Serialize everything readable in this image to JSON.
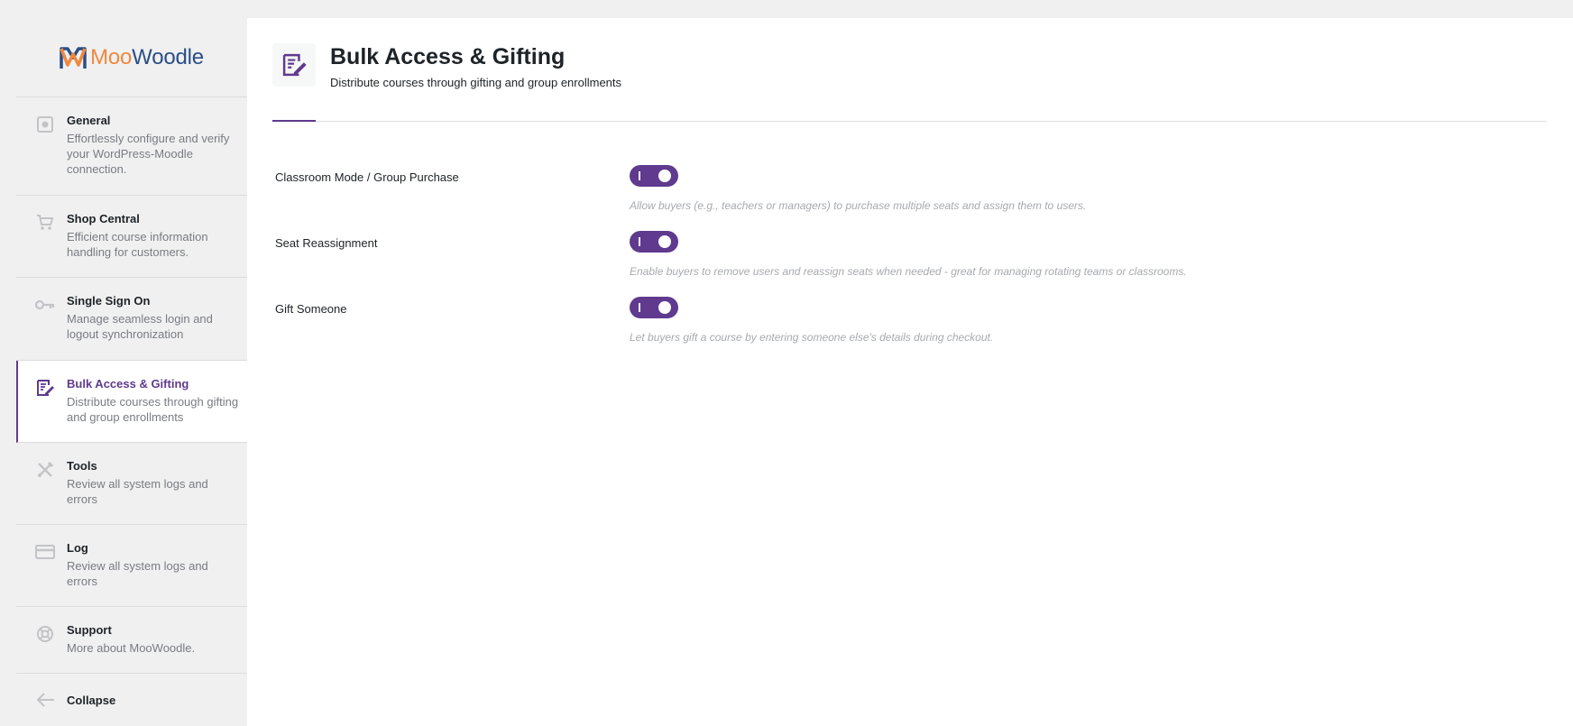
{
  "brand": {
    "name_part1": "Moo",
    "name_part2": "Woodle",
    "colors": {
      "orange": "#f0883e",
      "blue": "#2a4f86",
      "accent": "#5f3a8e"
    }
  },
  "sidebar": {
    "items": [
      {
        "id": "general",
        "icon": "gear-icon",
        "title": "General",
        "desc": "Effortlessly configure and verify your WordPress-Moodle connection.",
        "active": false
      },
      {
        "id": "shop",
        "icon": "cart-icon",
        "title": "Shop Central",
        "desc": "Efficient course information handling for customers.",
        "active": false
      },
      {
        "id": "sso",
        "icon": "key-icon",
        "title": "Single Sign On",
        "desc": "Manage seamless login and logout synchronization",
        "active": false
      },
      {
        "id": "bulk",
        "icon": "edit-note-icon",
        "title": "Bulk Access & Gifting",
        "desc": "Distribute courses through gifting and group enrollments",
        "active": true
      },
      {
        "id": "tools",
        "icon": "tools-icon",
        "title": "Tools",
        "desc": "Review all system logs and errors",
        "active": false
      },
      {
        "id": "log",
        "icon": "card-icon",
        "title": "Log",
        "desc": "Review all system logs and errors",
        "active": false
      },
      {
        "id": "support",
        "icon": "lifebuoy-icon",
        "title": "Support",
        "desc": "More about MooWoodle.",
        "active": false
      }
    ],
    "collapse_label": "Collapse"
  },
  "header": {
    "icon": "edit-note-icon",
    "title": "Bulk Access & Gifting",
    "subtitle": "Distribute courses through gifting and group enrollments"
  },
  "settings": [
    {
      "label": "Classroom Mode / Group Purchase",
      "enabled": true,
      "help": "Allow buyers (e.g., teachers or managers) to purchase multiple seats and assign them to users."
    },
    {
      "label": "Seat Reassignment",
      "enabled": true,
      "help": "Enable buyers to remove users and reassign seats when needed - great for managing rotating teams or classrooms."
    },
    {
      "label": "Gift Someone",
      "enabled": true,
      "help": "Let buyers gift a course by entering someone else's details during checkout."
    }
  ]
}
